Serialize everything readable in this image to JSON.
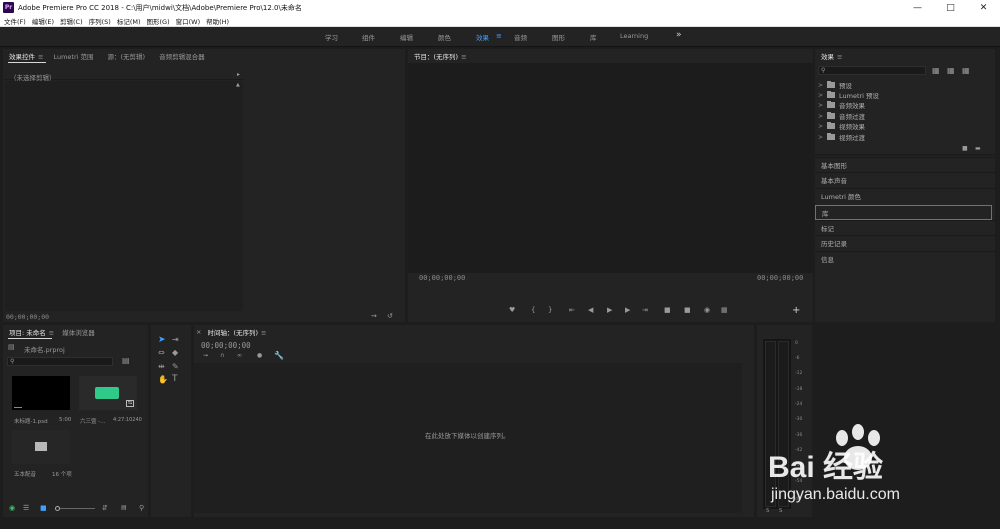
{
  "titlebar": {
    "app_icon": "Pr",
    "title": "Adobe Premiere Pro CC 2018 - C:\\用户\\midwi\\文档\\Adobe\\Premiere Pro\\12.0\\未命名",
    "minimize_icon": "minimize-icon",
    "maximize_icon": "maximize-icon",
    "close_icon": "close-icon"
  },
  "menubar": {
    "items": [
      "文件(F)",
      "编辑(E)",
      "剪辑(C)",
      "序列(S)",
      "标记(M)",
      "图形(G)",
      "窗口(W)",
      "帮助(H)"
    ]
  },
  "workspaces": {
    "tabs": [
      "学习",
      "组件",
      "编辑",
      "颜色",
      "效果",
      "音频",
      "图形",
      "库",
      "Learning"
    ],
    "active": "效果",
    "more_label": "»"
  },
  "effect_controls": {
    "tabs": [
      "效果控件",
      "Lumetri 范围",
      "源：(无剪辑)",
      "音频剪辑混合器"
    ],
    "no_clip_label": "（未选择剪辑）",
    "timecode": "00;00;00;00"
  },
  "program_monitor": {
    "title": "节目：(无序列)",
    "timecode_left": "00;00;00;00",
    "timecode_right": "00;00;00;00"
  },
  "effects_panel": {
    "title": "效果",
    "search_placeholder": "",
    "items": [
      "预设",
      "Lumetri 预设",
      "音频效果",
      "音频过渡",
      "视频效果",
      "视频过渡"
    ]
  },
  "side_sections": [
    "基本图形",
    "基本声音",
    "Lumetri 颜色",
    "库",
    "标记",
    "历史记录",
    "信息"
  ],
  "side_section_active": "库",
  "project": {
    "tabs": [
      "项目: 未命名",
      "媒体浏览器"
    ],
    "project_file": "未命名.prproj",
    "items": [
      {
        "name": "未标题-1.psd",
        "duration": "5:00"
      },
      {
        "name": "六三暨 -...",
        "duration": "4:27:10240"
      },
      {
        "name": "五本配音",
        "duration": "16 个项"
      }
    ]
  },
  "timeline": {
    "title": "时间轴：(无序列)",
    "timecode": "00;00;00;00",
    "drop_hint": "在此处放下媒体以创建序列。"
  },
  "audio_meter": {
    "scale": [
      "0",
      "-6",
      "-12",
      "-18",
      "-24",
      "-30",
      "-36",
      "-42",
      "-48",
      "-54",
      "dB"
    ],
    "solo_labels": [
      "S",
      "S"
    ]
  },
  "watermark": {
    "brand": "Bai 经验",
    "url": "jingyan.baidu.com"
  },
  "colors": {
    "accent": "#3fa0ff",
    "panel_bg": "#232323",
    "app_bg": "#1d1d1d"
  }
}
